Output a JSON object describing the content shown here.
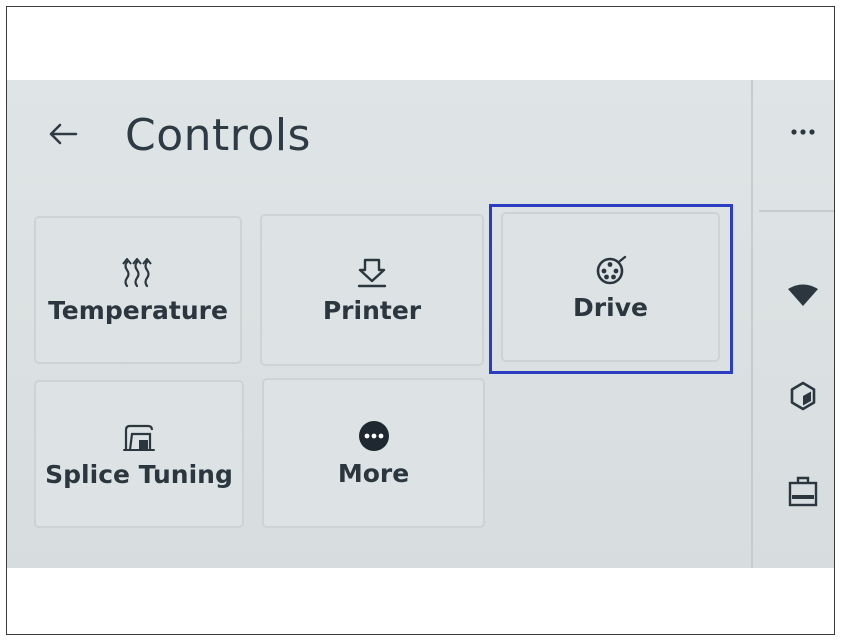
{
  "header": {
    "title": "Controls",
    "back_icon": "arrow-left-icon"
  },
  "tiles": [
    {
      "label": "Temperature",
      "icon": "heat-waves-icon"
    },
    {
      "label": "Printer",
      "icon": "printer-nozzle-icon"
    },
    {
      "label": "Drive",
      "icon": "spool-drive-icon",
      "highlighted": true
    },
    {
      "label": "Splice Tuning",
      "icon": "splice-icon"
    },
    {
      "label": "More",
      "icon": "more-dots-icon"
    }
  ],
  "side_rail": {
    "menu_icon": "ellipsis-icon",
    "icons": [
      "wifi-icon",
      "cube-icon",
      "printer-bed-icon"
    ]
  },
  "colors": {
    "screen_bg": "#dde3e4",
    "text": "#2b363f",
    "highlight": "#2b3ec2"
  }
}
